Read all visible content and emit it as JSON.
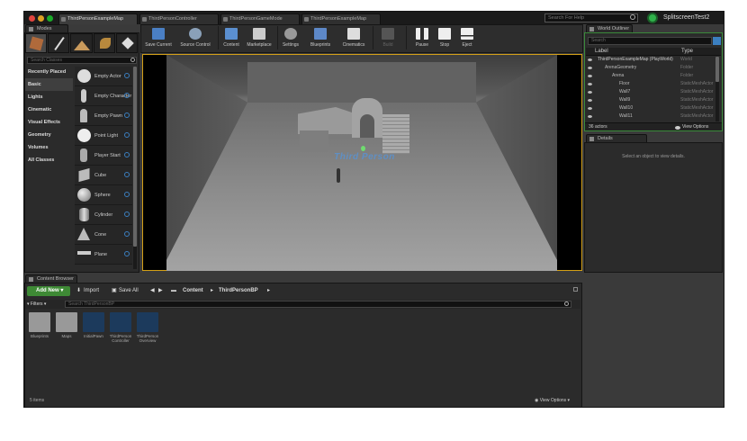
{
  "window": {
    "tabs": [
      "ThirdPersonExampleMap",
      "ThirdPersonController",
      "ThirdPersonGameMode",
      "ThirdPersonExampleMap"
    ],
    "search_help_placeholder": "Search For Help",
    "project_name": "SplitscreenTest2"
  },
  "modes": {
    "tab_label": "Modes",
    "search_placeholder": "Search Classes",
    "categories": [
      "Recently Placed",
      "Basic",
      "Lights",
      "Cinematic",
      "Visual Effects",
      "Geometry",
      "Volumes",
      "All Classes"
    ],
    "selected_category": "Basic",
    "items": [
      "Empty Actor",
      "Empty Character",
      "Empty Pawn",
      "Point Light",
      "Player Start",
      "Cube",
      "Sphere",
      "Cylinder",
      "Cone",
      "Plane"
    ]
  },
  "toolbar": {
    "buttons": [
      "Save Current",
      "Source Control",
      "Content",
      "Marketplace",
      "Settings",
      "Blueprints",
      "Cinematics",
      "Build",
      "Pause",
      "Stop",
      "Eject"
    ]
  },
  "viewport": {
    "overlay_text": "Third Person"
  },
  "outliner": {
    "tab_label": "World Outliner",
    "search_placeholder": "Search",
    "col_label": "Label",
    "col_type": "Type",
    "rows": [
      {
        "label": "ThirdPersonExampleMap (PlayWorld)",
        "type": "World"
      },
      {
        "label": "ArenaGeometry",
        "type": "Folder"
      },
      {
        "label": "Arena",
        "type": "Folder"
      },
      {
        "label": "Floor",
        "type": "StaticMeshActor"
      },
      {
        "label": "Wall7",
        "type": "StaticMeshActor"
      },
      {
        "label": "Wall9",
        "type": "StaticMeshActor"
      },
      {
        "label": "Wall10",
        "type": "StaticMeshActor"
      },
      {
        "label": "Wall11",
        "type": "StaticMeshActor"
      }
    ],
    "actor_count": "36 actors",
    "view_options": "View Options"
  },
  "details": {
    "tab_label": "Details",
    "empty_text": "Select an object to view details."
  },
  "content_browser": {
    "tab_label": "Content Browser",
    "add_new": "Add New",
    "import": "Import",
    "save_all": "Save All",
    "path": [
      "Content",
      "ThirdPersonBP"
    ],
    "filters": "Filters",
    "search_placeholder": "Search ThirdPersonBP",
    "assets": [
      "Blueprints",
      "Maps",
      "InitialPawn",
      "ThirdPerson Controller",
      "ThirdPerson Overview"
    ],
    "item_count": "5 items",
    "view_options": "View Options"
  }
}
